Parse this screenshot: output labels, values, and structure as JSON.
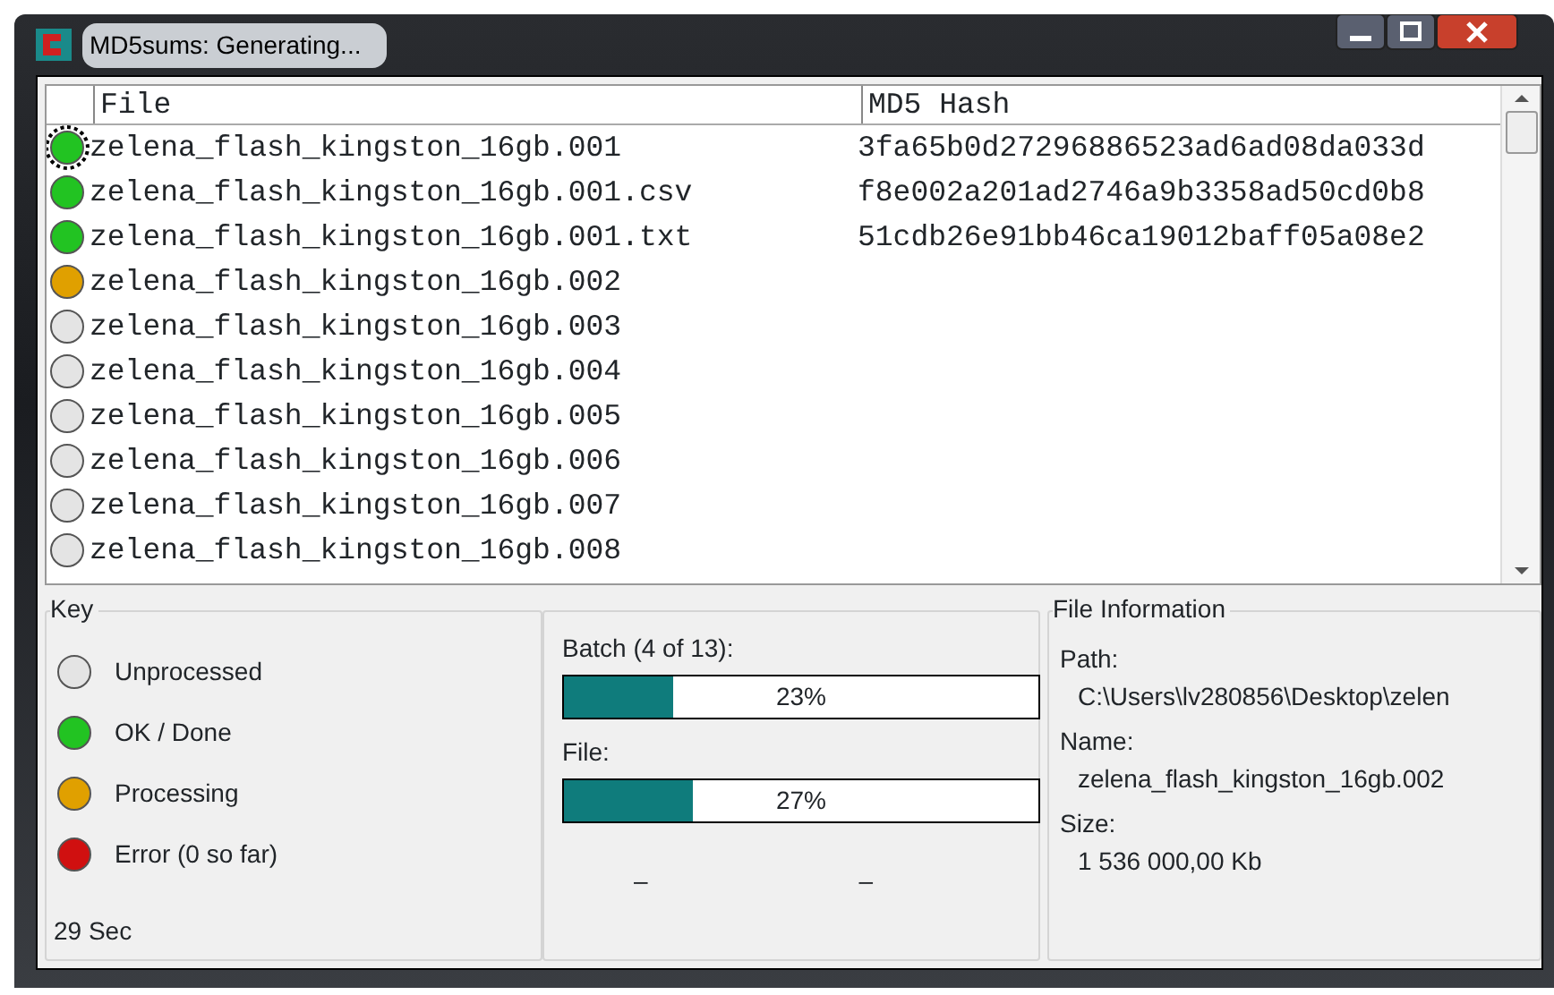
{
  "window": {
    "title": "MD5sums: Generating..."
  },
  "table": {
    "columns": [
      "File",
      "MD5 Hash"
    ],
    "rows": [
      {
        "file": "zelena_flash_kingston_16gb.001",
        "hash": "3fa65b0d27296886523ad6ad08da033d",
        "color": "#22c322",
        "selected": true
      },
      {
        "file": "zelena_flash_kingston_16gb.001.csv",
        "hash": "f8e002a201ad2746a9b3358ad50cd0b8",
        "color": "#22c322",
        "selected": false
      },
      {
        "file": "zelena_flash_kingston_16gb.001.txt",
        "hash": "51cdb26e91bb46ca19012baff05a08e2",
        "color": "#22c322",
        "selected": false
      },
      {
        "file": "zelena_flash_kingston_16gb.002",
        "color": "#e0a000",
        "selected": false
      },
      {
        "file": "zelena_flash_kingston_16gb.003",
        "color": "#e4e4e4",
        "selected": false
      },
      {
        "file": "zelena_flash_kingston_16gb.004",
        "color": "#e4e4e4",
        "selected": false
      },
      {
        "file": "zelena_flash_kingston_16gb.005",
        "color": "#e4e4e4",
        "selected": false
      },
      {
        "file": "zelena_flash_kingston_16gb.006",
        "color": "#e4e4e4",
        "selected": false
      },
      {
        "file": "zelena_flash_kingston_16gb.007",
        "color": "#e4e4e4",
        "selected": false
      },
      {
        "file": "zelena_flash_kingston_16gb.008",
        "color": "#e4e4e4",
        "selected": false
      }
    ]
  },
  "key": {
    "title": "Key",
    "items": [
      {
        "label": "Unprocessed",
        "color": "#e4e4e4"
      },
      {
        "label": "OK / Done",
        "color": "#22c322"
      },
      {
        "label": "Processing",
        "color": "#e0a000"
      },
      {
        "label": "Error (0 so far)",
        "color": "#d01010"
      }
    ],
    "elapsed": "29 Sec"
  },
  "progress": {
    "bars": [
      {
        "label": "Batch (4 of 13):",
        "level": 0.23,
        "reading": "23%"
      },
      {
        "label": "File:",
        "level": 0.27,
        "reading": "27%"
      }
    ],
    "dashes": [
      "–",
      "–"
    ]
  },
  "file_information": {
    "title": "File Information",
    "fields": [
      {
        "label": "Path:",
        "value": "C:\\Users\\lv280856\\Desktop\\zelen"
      },
      {
        "label": "Name:",
        "value": "zelena_flash_kingston_16gb.002"
      },
      {
        "label": "Size:",
        "value": "1 536 000,00 Kb"
      }
    ]
  }
}
